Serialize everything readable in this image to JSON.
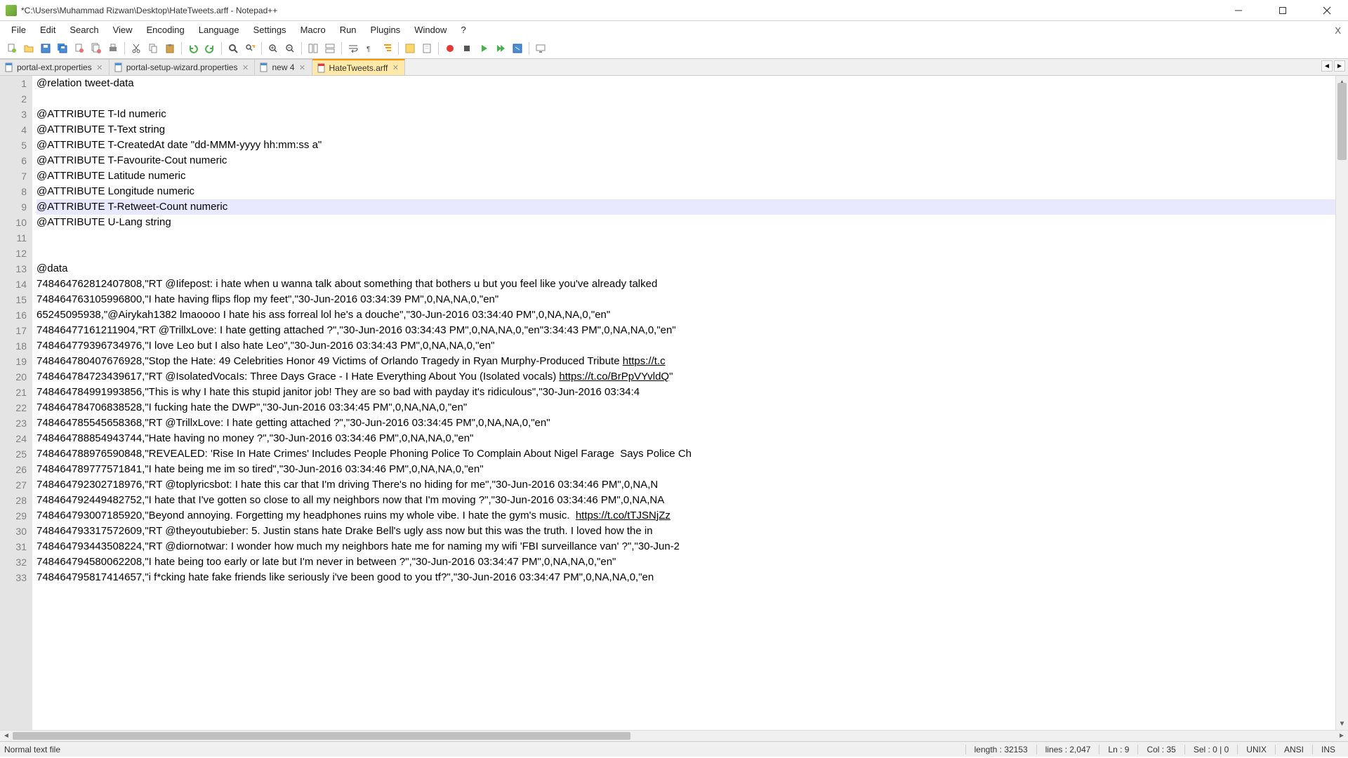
{
  "title": "*C:\\Users\\Muhammad Rizwan\\Desktop\\HateTweets.arff - Notepad++",
  "menu": [
    "File",
    "Edit",
    "Search",
    "View",
    "Encoding",
    "Language",
    "Settings",
    "Macro",
    "Run",
    "Plugins",
    "Window",
    "?"
  ],
  "close_main": "X",
  "tabs": [
    {
      "label": "portal-ext.properties",
      "active": false,
      "dirty": false
    },
    {
      "label": "portal-setup-wizard.properties",
      "active": false,
      "dirty": false
    },
    {
      "label": "new 4",
      "active": false,
      "dirty": false
    },
    {
      "label": "HateTweets.arff",
      "active": true,
      "dirty": true
    }
  ],
  "lines": [
    "@relation tweet-data",
    "",
    "@ATTRIBUTE T-Id numeric",
    "@ATTRIBUTE T-Text string",
    "@ATTRIBUTE T-CreatedAt date \"dd-MMM-yyyy hh:mm:ss a\"",
    "@ATTRIBUTE T-Favourite-Cout numeric",
    "@ATTRIBUTE Latitude numeric",
    "@ATTRIBUTE Longitude numeric",
    "@ATTRIBUTE T-Retweet-Count numeric",
    "@ATTRIBUTE U-Lang string",
    "",
    "",
    "@data",
    "748464762812407808,\"RT @Iifepost: i hate when u wanna talk about something that bothers u but you feel like you've already talked",
    "748464763105996800,\"I hate having flips flop my feet\",\"30-Jun-2016 03:34:39 PM\",0,NA,NA,0,\"en\"",
    "65245095938,\"@Airykah1382 lmaoooo I hate his ass forreal lol he's a douche\",\"30-Jun-2016 03:34:40 PM\",0,NA,NA,0,\"en\"",
    "74846477161211904,\"RT @TrillxLove: I hate getting attached ?\",\"30-Jun-2016 03:34:43 PM\",0,NA,NA,0,\"en\"3:34:43 PM\",0,NA,NA,0,\"en\"",
    "748464779396734976,\"I love Leo but I also hate Leo\",\"30-Jun-2016 03:34:43 PM\",0,NA,NA,0,\"en\"",
    "748464780407676928,\"Stop the Hate: 49 Celebrities Honor 49 Victims of Orlando Tragedy in Ryan Murphy-Produced Tribute https://t.c",
    "748464784723439617,\"RT @IsolatedVocaIs: Three Days Grace - I Hate Everything About You (Isolated vocals) https://t.co/BrPpVYvldQ\"",
    "748464784991993856,\"This is why I hate this stupid janitor job! They are so bad with payday it's ridiculous\",\"30-Jun-2016 03:34:4",
    "748464784706838528,\"I fucking hate the DWP\",\"30-Jun-2016 03:34:45 PM\",0,NA,NA,0,\"en\"",
    "748464785545658368,\"RT @TrillxLove: I hate getting attached ?\",\"30-Jun-2016 03:34:45 PM\",0,NA,NA,0,\"en\"",
    "748464788854943744,\"Hate having no money ?\",\"30-Jun-2016 03:34:46 PM\",0,NA,NA,0,\"en\"",
    "748464788976590848,\"REVEALED: 'Rise In Hate Crimes' Includes People Phoning Police To Complain About Nigel Farage  Says Police Ch",
    "748464789777571841,\"I hate being me im so tired\",\"30-Jun-2016 03:34:46 PM\",0,NA,NA,0,\"en\"",
    "748464792302718976,\"RT @toplyricsbot: I hate this car that I'm driving There's no hiding for me\",\"30-Jun-2016 03:34:46 PM\",0,NA,N",
    "748464792449482752,\"I hate that I've gotten so close to all my neighbors now that I'm moving ?\",\"30-Jun-2016 03:34:46 PM\",0,NA,NA",
    "748464793007185920,\"Beyond annoying. Forgetting my headphones ruins my whole vibe. I hate the gym's music.  https://t.co/tTJSNjZz",
    "748464793317572609,\"RT @theyoutubieber: 5. Justin stans hate Drake Bell's ugly ass now but this was the truth. I loved how the in",
    "748464793443508224,\"RT @diornotwar: I wonder how much my neighbors hate me for naming my wifi 'FBI surveillance van' ?\",\"30-Jun-2",
    "748464794580062208,\"I hate being too early or late but I'm never in between ?\",\"30-Jun-2016 03:34:47 PM\",0,NA,NA,0,\"en\"",
    "748464795817414657,\"i f*cking hate fake friends like seriously i've been good to you tf?\",\"30-Jun-2016 03:34:47 PM\",0,NA,NA,0,\"en"
  ],
  "highlight_line": 9,
  "status": {
    "left": "Normal text file",
    "length": "length : 32153",
    "lines": "lines : 2,047",
    "ln": "Ln : 9",
    "col": "Col : 35",
    "sel": "Sel : 0 | 0",
    "eol": "UNIX",
    "enc": "ANSI",
    "mode": "INS"
  },
  "toolbar_icons": [
    "new-file-icon",
    "open-file-icon",
    "save-icon",
    "save-all-icon",
    "close-icon",
    "close-all-icon",
    "print-icon",
    "sep",
    "cut-icon",
    "copy-icon",
    "paste-icon",
    "sep",
    "undo-icon",
    "redo-icon",
    "sep",
    "find-icon",
    "replace-icon",
    "sep",
    "zoom-in-icon",
    "zoom-out-icon",
    "sep",
    "sync-v-icon",
    "sync-h-icon",
    "sep",
    "word-wrap-icon",
    "show-all-chars-icon",
    "indent-guide-icon",
    "sep",
    "lang-icon",
    "doc-map-icon",
    "sep",
    "record-icon",
    "stop-icon",
    "play-icon",
    "play-multi-icon",
    "save-macro-icon",
    "sep",
    "monitor-icon"
  ]
}
